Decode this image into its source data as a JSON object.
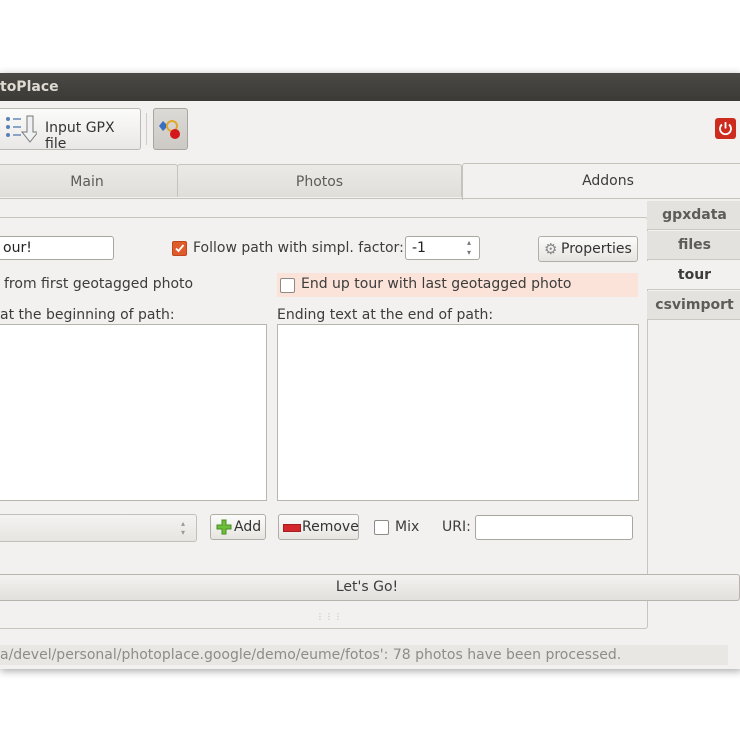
{
  "window": {
    "title": "toPlace"
  },
  "toolbar": {
    "gpx_button_label": "Input GPX file",
    "geotag_button_icon": "geotag-icon",
    "power_icon": "power-icon"
  },
  "tabs": [
    {
      "label": "Main"
    },
    {
      "label": "Photos"
    },
    {
      "label": "Addons",
      "active": true
    }
  ],
  "side_tabs": [
    {
      "label": "gpxdata"
    },
    {
      "label": "files"
    },
    {
      "label": "tour",
      "active": true
    },
    {
      "label": "csvimport"
    }
  ],
  "tour": {
    "name_value": "our!",
    "follow_path_label": "Follow path with simpl. factor:",
    "follow_path_checked": true,
    "factor_value": "-1",
    "properties_label": "Properties",
    "start_label": "from first geotagged photo",
    "end_label": "End up tour with last geotagged photo",
    "end_checked": false,
    "begin_text_label": "at the beginning of path:",
    "end_text_label": "Ending text at the end of path:",
    "add_label": "Add",
    "remove_label": "Remove",
    "mix_label": "Mix",
    "mix_checked": false,
    "uri_label": "URI:",
    "uri_value": ""
  },
  "actions": {
    "go_label": "Let's Go!"
  },
  "status": {
    "text": "a/devel/personal/photoplace.google/demo/eume/fotos': 78 photos have been processed."
  },
  "colors": {
    "accent": "#e05b2b",
    "highlight": "#fbe3d9",
    "titlebar": "#3c3b37",
    "power": "#cc2b1e"
  }
}
